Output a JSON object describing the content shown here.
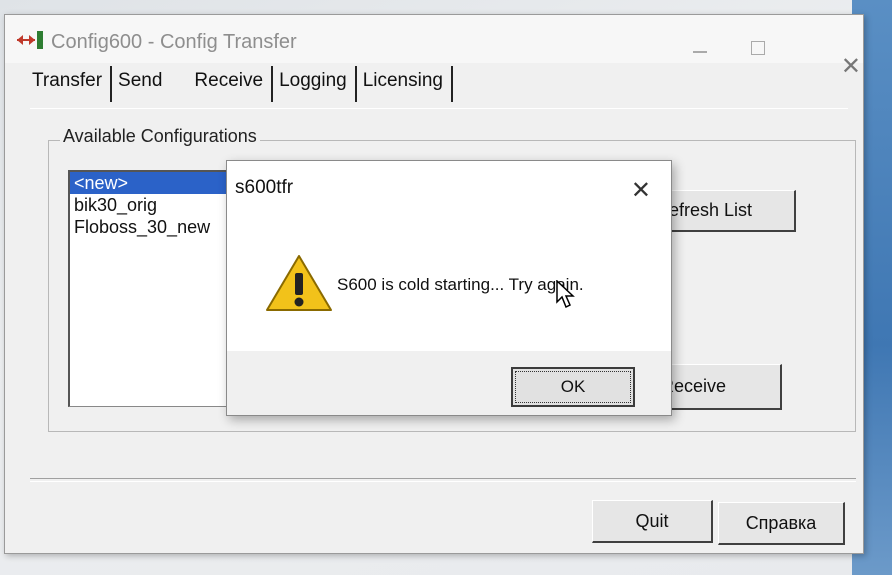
{
  "window": {
    "title": "Config600 - Config Transfer"
  },
  "tabs": [
    {
      "label": "Transfer"
    },
    {
      "label": "Send"
    },
    {
      "label": "Receive"
    },
    {
      "label": "Logging"
    },
    {
      "label": "Licensing"
    }
  ],
  "configurations": {
    "group_label": "Available Configurations",
    "items": [
      {
        "label": "<new>",
        "selected": true
      },
      {
        "label": "bik30_orig",
        "selected": false
      },
      {
        "label": "Floboss_30_new",
        "selected": false
      }
    ]
  },
  "buttons": {
    "refresh_label": "efresh List",
    "receive_label": "Receive",
    "quit_label": "Quit",
    "help_label": "Справка"
  },
  "dialog": {
    "title": "s600tfr",
    "message": "S600 is cold starting... Try again.",
    "ok_label": "OK",
    "icon": "warning-icon"
  },
  "colors": {
    "selection": "#2b62c8",
    "warning_yellow": "#f2c21a"
  }
}
